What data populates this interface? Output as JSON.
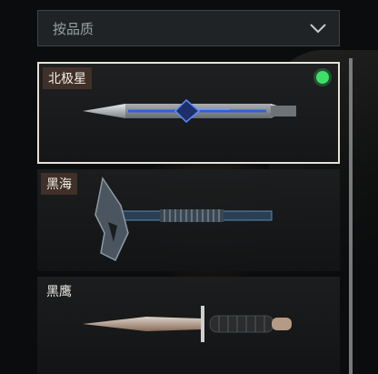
{
  "filter": {
    "label": "按品质",
    "icon": "chevron-down-icon"
  },
  "items": [
    {
      "name": "北极星",
      "owned": true,
      "selected": true,
      "icon": "combat-knife-icon"
    },
    {
      "name": "黑海",
      "owned": false,
      "selected": false,
      "icon": "tomahawk-axe-icon"
    },
    {
      "name": "黑鹰",
      "owned": false,
      "selected": false,
      "icon": "dagger-icon"
    }
  ],
  "colors": {
    "owned": "#3ee06a",
    "selected_border": "#e6e2d6",
    "name_tag": "#46342a"
  }
}
